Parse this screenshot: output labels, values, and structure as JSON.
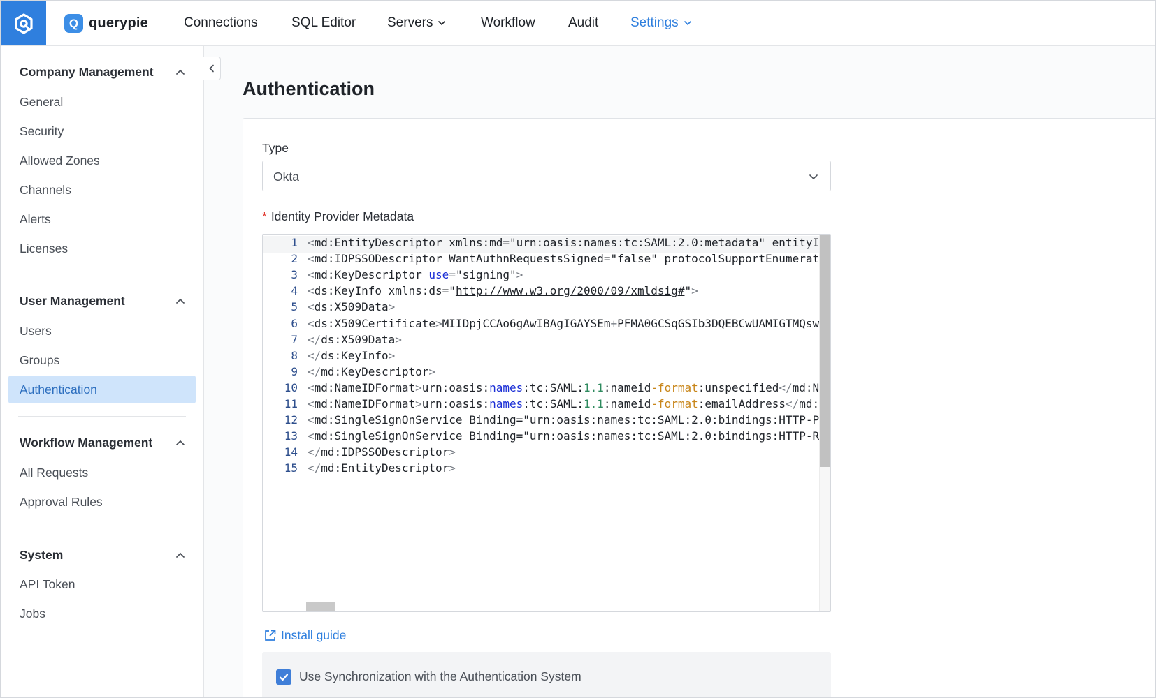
{
  "brand": {
    "name": "querypie",
    "badge_letter": "Q",
    "accent": "#2f7fde"
  },
  "nav": [
    {
      "label": "Connections",
      "dropdown": false,
      "active": false
    },
    {
      "label": "SQL Editor",
      "dropdown": false,
      "active": false
    },
    {
      "label": "Servers",
      "dropdown": true,
      "active": false
    },
    {
      "label": "Workflow",
      "dropdown": false,
      "active": false
    },
    {
      "label": "Audit",
      "dropdown": false,
      "active": false
    },
    {
      "label": "Settings",
      "dropdown": true,
      "active": true
    }
  ],
  "sidebar": {
    "sections": [
      {
        "title": "Company Management",
        "items": [
          "General",
          "Security",
          "Allowed Zones",
          "Channels",
          "Alerts",
          "Licenses"
        ]
      },
      {
        "title": "User Management",
        "items": [
          "Users",
          "Groups",
          "Authentication"
        ]
      },
      {
        "title": "Workflow Management",
        "items": [
          "All Requests",
          "Approval Rules"
        ]
      },
      {
        "title": "System",
        "items": [
          "API Token",
          "Jobs"
        ]
      }
    ],
    "active_item": "Authentication"
  },
  "main": {
    "title": "Authentication",
    "type_label": "Type",
    "type_value": "Okta",
    "metadata_label": "Identity Provider Metadata",
    "metadata_required_mark": "*",
    "install_guide_label": "Install guide",
    "sync_label": "Use Synchronization with the Authentication System",
    "sync_checked": true
  },
  "editor": {
    "lines": [
      [
        [
          "tag",
          "<"
        ],
        [
          "str",
          "md:EntityDescriptor xmlns:md=\"urn:oasis:names:tc:SAML:2.0:metadata\" entityI"
        ]
      ],
      [
        [
          "tag",
          "<"
        ],
        [
          "str",
          "md:IDPSSODescriptor WantAuthnRequestsSigned=\"false\" protocolSupportEnumerati"
        ]
      ],
      [
        [
          "tag",
          "<"
        ],
        [
          "str",
          "md:KeyDescriptor "
        ],
        [
          "kw",
          "use"
        ],
        [
          "tag",
          "="
        ],
        [
          "str",
          "\"signing\""
        ],
        [
          "tag",
          ">"
        ]
      ],
      [
        [
          "tag",
          "<"
        ],
        [
          "str",
          "ds:KeyInfo xmlns:ds=\""
        ],
        [
          "link",
          "http://www.w3.org/2000/09/xmldsig#"
        ],
        [
          "str",
          "\""
        ],
        [
          "tag",
          ">"
        ]
      ],
      [
        [
          "tag",
          "<"
        ],
        [
          "str",
          "ds:X509Data"
        ],
        [
          "tag",
          ">"
        ]
      ],
      [
        [
          "tag",
          "<"
        ],
        [
          "str",
          "ds:X509Certificate"
        ],
        [
          "tag",
          ">"
        ],
        [
          "str",
          "MIIDpjCCAo6gAwIBAgIGAYSEm"
        ],
        [
          "tag",
          "+"
        ],
        [
          "str",
          "PFMA0GCSqGSIb3DQEBCwUAMIGTMQsw("
        ]
      ],
      [
        [
          "tag",
          "</"
        ],
        [
          "str",
          "ds:X509Data"
        ],
        [
          "tag",
          ">"
        ]
      ],
      [
        [
          "tag",
          "</"
        ],
        [
          "str",
          "ds:KeyInfo"
        ],
        [
          "tag",
          ">"
        ]
      ],
      [
        [
          "tag",
          "</"
        ],
        [
          "str",
          "md:KeyDescriptor"
        ],
        [
          "tag",
          ">"
        ]
      ],
      [
        [
          "tag",
          "<"
        ],
        [
          "str",
          "md:NameIDFormat"
        ],
        [
          "tag",
          ">"
        ],
        [
          "str",
          "urn:oasis:"
        ],
        [
          "kw",
          "names"
        ],
        [
          "str",
          ":tc:SAML:"
        ],
        [
          "num",
          "1.1"
        ],
        [
          "str",
          ":nameid"
        ],
        [
          "fmt",
          "-format"
        ],
        [
          "str",
          ":unspecified"
        ],
        [
          "tag",
          "</"
        ],
        [
          "str",
          "md:Na"
        ]
      ],
      [
        [
          "tag",
          "<"
        ],
        [
          "str",
          "md:NameIDFormat"
        ],
        [
          "tag",
          ">"
        ],
        [
          "str",
          "urn:oasis:"
        ],
        [
          "kw",
          "names"
        ],
        [
          "str",
          ":tc:SAML:"
        ],
        [
          "num",
          "1.1"
        ],
        [
          "str",
          ":nameid"
        ],
        [
          "fmt",
          "-format"
        ],
        [
          "str",
          ":emailAddress"
        ],
        [
          "tag",
          "</"
        ],
        [
          "str",
          "md:N"
        ]
      ],
      [
        [
          "tag",
          "<"
        ],
        [
          "str",
          "md:SingleSignOnService Binding=\"urn:oasis:names:tc:SAML:2.0:bindings:HTTP-PO"
        ]
      ],
      [
        [
          "tag",
          "<"
        ],
        [
          "str",
          "md:SingleSignOnService Binding=\"urn:oasis:names:tc:SAML:2.0:bindings:HTTP-Re"
        ]
      ],
      [
        [
          "tag",
          "</"
        ],
        [
          "str",
          "md:IDPSSODescriptor"
        ],
        [
          "tag",
          ">"
        ]
      ],
      [
        [
          "tag",
          "</"
        ],
        [
          "str",
          "md:EntityDescriptor"
        ],
        [
          "tag",
          ">"
        ]
      ]
    ]
  },
  "icons": {
    "logo": "querypie-logo-icon",
    "collapse": "chevron-left-icon",
    "external_link": "external-link-icon",
    "check": "check-icon"
  }
}
